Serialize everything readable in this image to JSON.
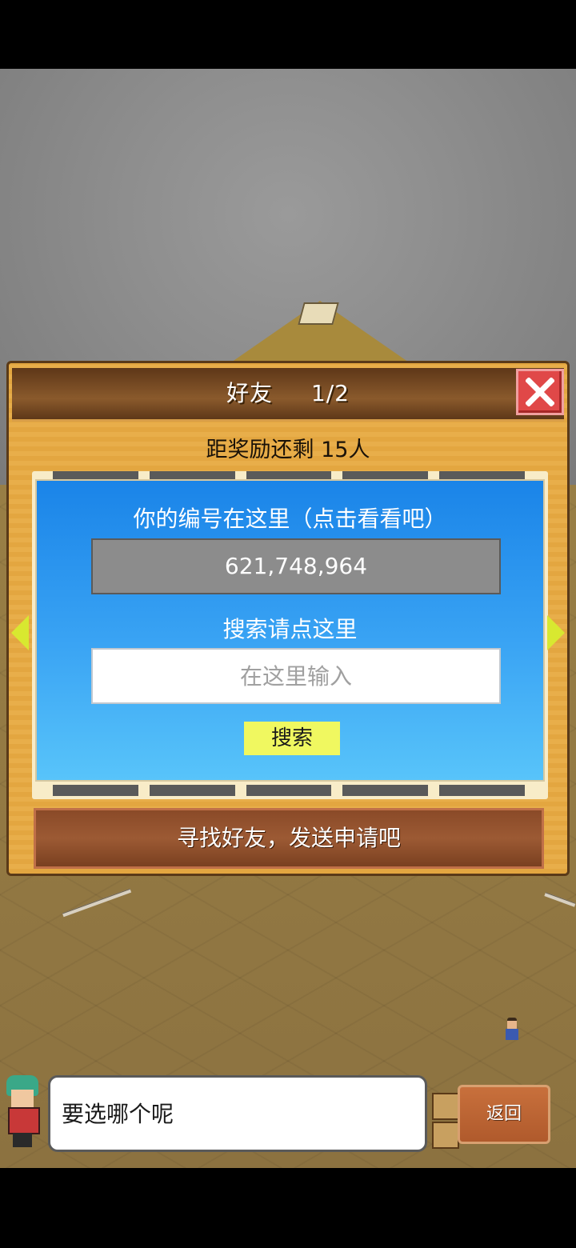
{
  "dialog": {
    "title": "好友",
    "page_indicator": "1/2",
    "reward_text": "距奖励还剩 15人",
    "id_label": "你的编号在这里（点击看看吧）",
    "player_id": "621,748,964",
    "search_label": "搜索请点这里",
    "search_placeholder": "在这里输入",
    "search_button": "搜索",
    "find_button": "寻找好友，发送申请吧"
  },
  "hint": {
    "speech_text": "要选哪个呢"
  },
  "back_button": "返回",
  "colors": {
    "card_top": "#1a84e8",
    "card_bottom": "#58c4fa",
    "close": "#e04848",
    "search_button": "#f0f860"
  },
  "icons": [
    "close-icon",
    "arrow-left-icon",
    "arrow-right-icon"
  ]
}
